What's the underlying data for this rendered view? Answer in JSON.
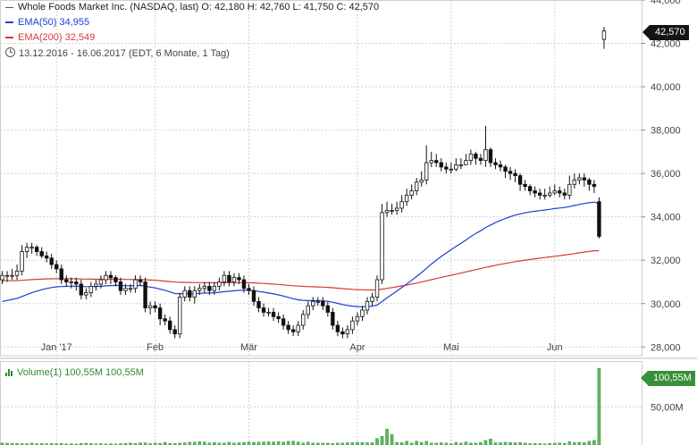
{
  "legend": {
    "title": "Whole Foods Market Inc. (NASDAQ, last)  O: 42,180  H: 42,760  L: 41,750  C: 42,570",
    "ema50": "EMA(50)  34,955",
    "ema200": "EMA(200)  32,549",
    "range": "13.12.2016 - 16.06.2017    (EDT, 6 Monate, 1 Tag)"
  },
  "price_tag": "42,570",
  "volume_legend": "Volume(1)  100,55M   100,55M",
  "volume_tag": "100,55M",
  "colors": {
    "up": "#ffffff",
    "down": "#111111",
    "ema50": "#1f3fd0",
    "ema200": "#d63a3a",
    "volume": "#5cb85c",
    "grid": "#d0d0d0"
  },
  "chart_data": [
    {
      "type": "candlestick",
      "title": "Whole Foods Market Inc. (NASDAQ, last)",
      "ylim": [
        27.6,
        44.0
      ],
      "y_ticks": [
        {
          "value": 44,
          "label": "44,000"
        },
        {
          "value": 42,
          "label": "42,000"
        },
        {
          "value": 40,
          "label": "40,000"
        },
        {
          "value": 38,
          "label": "38,000"
        },
        {
          "value": 36,
          "label": "36,000"
        },
        {
          "value": 34,
          "label": "34,000"
        },
        {
          "value": 32,
          "label": "32,000"
        },
        {
          "value": 30,
          "label": "30,000"
        },
        {
          "value": 28,
          "label": "28,000"
        }
      ],
      "x_ticks": [
        {
          "index": 11,
          "label": "Jan '17"
        },
        {
          "index": 31,
          "label": "Feb"
        },
        {
          "index": 50,
          "label": "Mär"
        },
        {
          "index": 72,
          "label": "Apr"
        },
        {
          "index": 91,
          "label": "Mai"
        },
        {
          "index": 112,
          "label": "Jun"
        }
      ],
      "grid": true,
      "close": [
        31.3,
        31.3,
        31.3,
        31.5,
        32.4,
        32.6,
        32.6,
        32.4,
        32.2,
        32.1,
        31.8,
        31.6,
        31.1,
        31.0,
        31.0,
        30.9,
        30.4,
        30.5,
        30.8,
        30.9,
        31.1,
        31.3,
        31.2,
        31.0,
        30.6,
        30.7,
        30.7,
        31.1,
        31.0,
        29.8,
        29.9,
        29.8,
        29.3,
        29.2,
        28.8,
        28.6,
        30.3,
        30.6,
        30.3,
        30.6,
        30.7,
        30.8,
        30.6,
        30.8,
        31.0,
        31.3,
        31.0,
        31.2,
        31.1,
        30.7,
        30.6,
        30.1,
        29.8,
        29.6,
        29.6,
        29.4,
        29.3,
        29.0,
        28.8,
        28.7,
        29.0,
        29.5,
        29.9,
        30.1,
        30.1,
        29.9,
        29.6,
        29.0,
        28.7,
        28.6,
        28.8,
        29.2,
        29.4,
        29.7,
        30.1,
        30.3,
        31.1,
        34.2,
        34.3,
        34.3,
        34.4,
        34.7,
        35.0,
        35.2,
        35.6,
        35.7,
        36.5,
        36.6,
        36.5,
        36.3,
        36.2,
        36.2,
        36.4,
        36.4,
        36.6,
        36.9,
        36.7,
        36.6,
        37.1,
        36.5,
        36.4,
        36.3,
        36.1,
        36.0,
        35.9,
        35.5,
        35.4,
        35.2,
        35.1,
        35.0,
        35.0,
        35.1,
        35.2,
        35.1,
        35.0,
        35.5,
        35.7,
        35.8,
        35.7,
        35.5,
        35.4,
        33.1,
        42.57
      ],
      "open": [
        31.1,
        31.3,
        31.3,
        31.3,
        31.5,
        32.4,
        32.6,
        32.6,
        32.4,
        32.2,
        32.1,
        31.8,
        31.6,
        31.1,
        31.0,
        31.0,
        30.9,
        30.4,
        30.5,
        30.8,
        30.9,
        31.1,
        31.3,
        31.2,
        31.0,
        30.6,
        30.7,
        30.7,
        31.1,
        31.0,
        29.8,
        29.9,
        29.8,
        29.3,
        29.2,
        28.8,
        28.6,
        30.3,
        30.6,
        30.3,
        30.6,
        30.7,
        30.8,
        30.6,
        30.8,
        31.0,
        31.3,
        31.0,
        31.2,
        31.1,
        30.7,
        30.6,
        30.1,
        29.8,
        29.6,
        29.6,
        29.4,
        29.3,
        29.0,
        28.8,
        28.7,
        29.0,
        29.5,
        29.9,
        30.1,
        30.1,
        29.9,
        29.6,
        29.0,
        28.7,
        28.6,
        28.8,
        29.2,
        29.4,
        29.7,
        30.1,
        30.3,
        31.1,
        34.2,
        34.3,
        34.3,
        34.4,
        34.7,
        35.0,
        35.2,
        35.6,
        35.7,
        36.5,
        36.6,
        36.5,
        36.3,
        36.2,
        36.2,
        36.4,
        36.4,
        36.6,
        36.9,
        36.7,
        36.6,
        37.1,
        36.5,
        36.4,
        36.3,
        36.1,
        36.0,
        35.9,
        35.5,
        35.4,
        35.2,
        35.1,
        35.0,
        35.0,
        35.1,
        35.2,
        35.1,
        35.0,
        35.5,
        35.7,
        35.8,
        35.7,
        35.5,
        34.7,
        42.18
      ],
      "high": [
        31.5,
        31.5,
        31.6,
        31.8,
        32.7,
        32.8,
        32.8,
        32.7,
        32.6,
        32.4,
        32.3,
        32.0,
        31.8,
        31.3,
        31.2,
        31.2,
        31.1,
        30.7,
        31.0,
        31.1,
        31.3,
        31.5,
        31.5,
        31.3,
        31.2,
        30.9,
        30.9,
        31.3,
        31.3,
        31.2,
        30.1,
        30.1,
        30.0,
        29.5,
        29.4,
        29.0,
        30.5,
        30.8,
        30.8,
        30.8,
        30.9,
        31.0,
        31.0,
        31.0,
        31.2,
        31.5,
        31.5,
        31.4,
        31.4,
        31.3,
        30.9,
        30.8,
        30.3,
        30.0,
        29.8,
        29.8,
        29.6,
        29.5,
        29.2,
        29.0,
        29.2,
        29.7,
        30.1,
        30.3,
        30.3,
        30.3,
        30.1,
        29.8,
        29.2,
        28.9,
        29.0,
        29.4,
        29.6,
        29.9,
        30.3,
        30.5,
        31.3,
        34.6,
        34.7,
        34.6,
        34.7,
        35.0,
        35.3,
        35.5,
        35.8,
        36.1,
        37.3,
        37.0,
        36.9,
        36.7,
        36.5,
        36.5,
        36.7,
        36.7,
        36.9,
        37.1,
        37.0,
        36.9,
        38.2,
        37.2,
        36.7,
        36.6,
        36.4,
        36.3,
        36.2,
        36.0,
        35.7,
        35.5,
        35.4,
        35.3,
        35.3,
        35.4,
        35.5,
        35.4,
        35.3,
        35.9,
        36.0,
        36.0,
        36.0,
        35.8,
        35.7,
        34.9,
        42.76
      ],
      "low": [
        30.9,
        31.0,
        31.1,
        31.1,
        31.3,
        32.1,
        32.3,
        32.2,
        32.1,
        31.9,
        31.6,
        31.4,
        30.9,
        30.8,
        30.7,
        30.6,
        30.2,
        30.2,
        30.3,
        30.6,
        30.7,
        30.9,
        30.9,
        30.8,
        30.4,
        30.4,
        30.5,
        30.5,
        30.8,
        29.6,
        29.5,
        29.6,
        29.0,
        29.0,
        28.6,
        28.4,
        28.4,
        30.1,
        30.1,
        30.0,
        30.4,
        30.5,
        30.4,
        30.4,
        30.6,
        30.8,
        30.8,
        30.8,
        30.9,
        30.5,
        30.4,
        29.9,
        29.6,
        29.4,
        29.4,
        29.2,
        29.1,
        28.8,
        28.6,
        28.5,
        28.5,
        28.8,
        29.3,
        29.7,
        29.9,
        29.7,
        29.4,
        28.8,
        28.5,
        28.4,
        28.4,
        28.6,
        29.0,
        29.2,
        29.5,
        29.9,
        30.1,
        30.9,
        34.0,
        34.1,
        34.1,
        34.2,
        34.5,
        34.8,
        35.0,
        35.4,
        35.5,
        36.3,
        36.3,
        36.1,
        36.0,
        36.0,
        36.1,
        36.2,
        36.4,
        36.4,
        36.4,
        36.4,
        36.3,
        36.3,
        36.2,
        36.1,
        35.8,
        35.7,
        35.6,
        35.2,
        35.2,
        35.0,
        34.9,
        34.8,
        34.8,
        34.9,
        35.0,
        34.9,
        34.8,
        34.8,
        35.3,
        35.5,
        35.4,
        35.2,
        35.1,
        33.0,
        41.75
      ],
      "ema50_label": "EMA(50)",
      "ema50_last": 34.955,
      "ema200_label": "EMA(200)",
      "ema200_last": 32.549
    },
    {
      "type": "bar",
      "title": "Volume(1)",
      "y_ticks": [
        {
          "value": 50,
          "label": "50,00M"
        }
      ],
      "ylim": [
        0,
        110
      ],
      "values": [
        2.6,
        2.4,
        2.2,
        2.1,
        1.8,
        1.8,
        2.5,
        1.8,
        2.0,
        1.7,
        2.0,
        1.9,
        2.2,
        1.5,
        1.7,
        1.3,
        2.1,
        2.4,
        1.9,
        1.6,
        1.8,
        1.5,
        1.7,
        1.5,
        1.9,
        2.0,
        2.7,
        2.2,
        2.9,
        2.9,
        1.9,
        2.7,
        2.2,
        3.5,
        2.0,
        1.9,
        2.5,
        3.0,
        3.7,
        3.9,
        4.5,
        3.9,
        2.8,
        3.2,
        2.8,
        2.5,
        3.7,
        2.7,
        3.0,
        3.4,
        4.0,
        3.5,
        3.9,
        4.1,
        4.2,
        4.1,
        4.5,
        3.9,
        4.8,
        5.0,
        4.0,
        2.8,
        4.0,
        2.5,
        2.5,
        2.5,
        2.5,
        2.0,
        2.5,
        2.7,
        3.0,
        3.2,
        3.5,
        3.3,
        3.0,
        3.0,
        8.7,
        11.4,
        21.0,
        13.7,
        3.5,
        3.1,
        5.0,
        2.6,
        5.1,
        3.5,
        4.9,
        2.5,
        2.6,
        3.0,
        2.7,
        1.8,
        3.5,
        2.5,
        4.0,
        2.5,
        2.5,
        3.5,
        6.0,
        8.0,
        3.0,
        3.0,
        3.6,
        3.2,
        3.0,
        3.2,
        2.5,
        1.8,
        2.0,
        1.8,
        1.5,
        2.1,
        2.7,
        2.8,
        2.0,
        4.5,
        3.2,
        3.6,
        3.1,
        5.0,
        6.0,
        100.55
      ]
    }
  ]
}
